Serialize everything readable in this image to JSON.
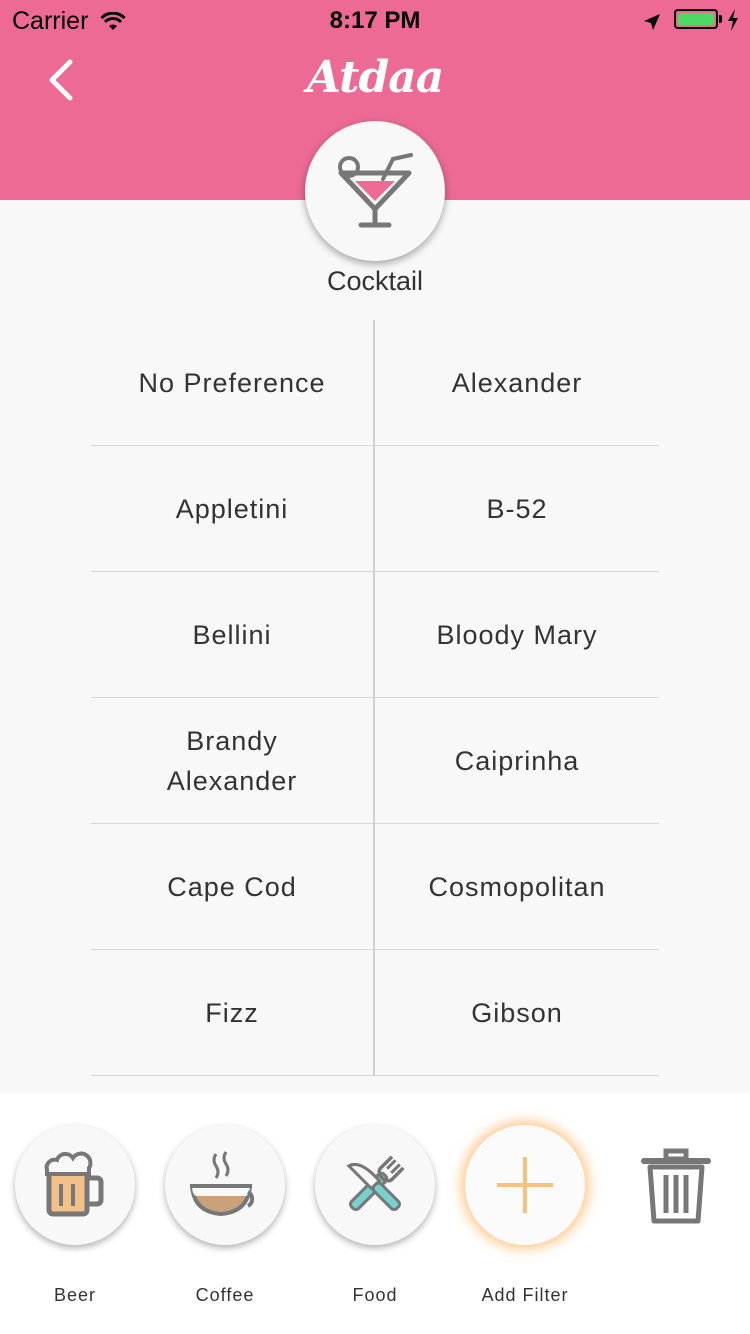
{
  "status_bar": {
    "carrier": "Carrier",
    "time": "8:17 PM"
  },
  "header": {
    "logo": "Atdaa",
    "category_icon": "cocktail-icon",
    "category_label": "Cocktail",
    "color": "#ec6a94"
  },
  "options": [
    [
      "No Preference",
      "Alexander"
    ],
    [
      "Appletini",
      "B-52"
    ],
    [
      "Bellini",
      "Bloody Mary"
    ],
    [
      "Brandy Alexander",
      "Caiprinha"
    ],
    [
      "Cape Cod",
      "Cosmopolitan"
    ],
    [
      "Fizz",
      "Gibson"
    ]
  ],
  "filters": [
    {
      "label": "Beer",
      "icon": "beer-icon"
    },
    {
      "label": "Coffee",
      "icon": "coffee-icon"
    },
    {
      "label": "Food",
      "icon": "food-icon"
    },
    {
      "label": "Add Filter",
      "icon": "plus-icon"
    }
  ],
  "trash_icon": "trash-icon"
}
